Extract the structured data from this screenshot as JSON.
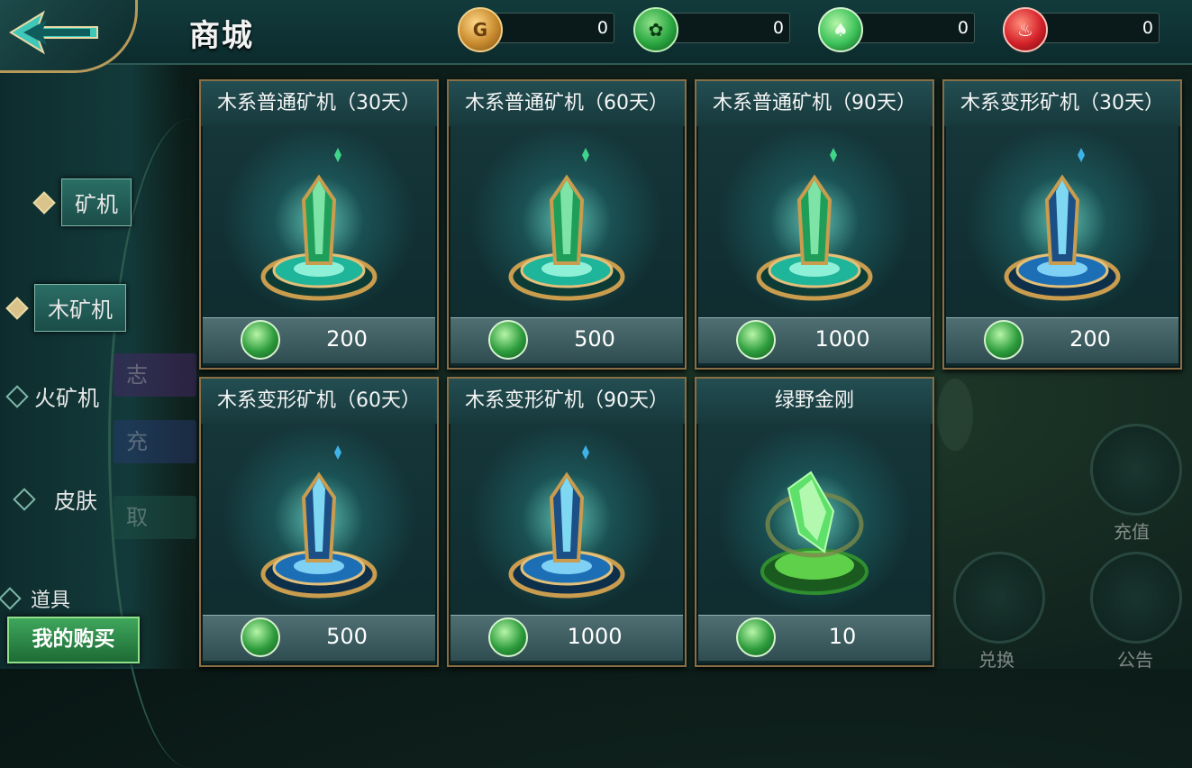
{
  "header": {
    "title": "商城",
    "back_icon": "back-arrow-icon"
  },
  "currencies": [
    {
      "icon": "gold-coin-icon",
      "color": "#c88a2e",
      "value": "0"
    },
    {
      "icon": "green-token-icon",
      "color": "#2aa640",
      "value": "0"
    },
    {
      "icon": "green-crystal-icon",
      "color": "#3cc25a",
      "value": "0"
    },
    {
      "icon": "red-flame-icon",
      "color": "#d4222a",
      "value": "0"
    }
  ],
  "sidebar": {
    "items": [
      {
        "label": "矿机"
      },
      {
        "label": "木矿机"
      },
      {
        "label": "火矿机"
      },
      {
        "label": "皮肤"
      },
      {
        "label": "道具"
      }
    ],
    "buy_button": "我的购买",
    "ghost_tabs": [
      "志",
      "充",
      "取"
    ]
  },
  "products": [
    {
      "title": "木系普通矿机（30天）",
      "price": "200",
      "style": "green"
    },
    {
      "title": "木系普通矿机（60天）",
      "price": "500",
      "style": "green"
    },
    {
      "title": "木系普通矿机（90天）",
      "price": "1000",
      "style": "green"
    },
    {
      "title": "木系变形矿机（30天）",
      "price": "200",
      "style": "blue"
    },
    {
      "title": "木系变形矿机（60天）",
      "price": "500",
      "style": "blue"
    },
    {
      "title": "木系变形矿机（90天）",
      "price": "1000",
      "style": "blue"
    },
    {
      "title": "绿野金刚",
      "price": "10",
      "style": "crystal"
    }
  ],
  "background_buttons": [
    {
      "label": "充值"
    },
    {
      "label": "兑换"
    },
    {
      "label": "公告"
    }
  ],
  "colors": {
    "card_border": "#8a6f45",
    "accent_green": "#3fa65c",
    "header_bg": "#123b3c"
  }
}
